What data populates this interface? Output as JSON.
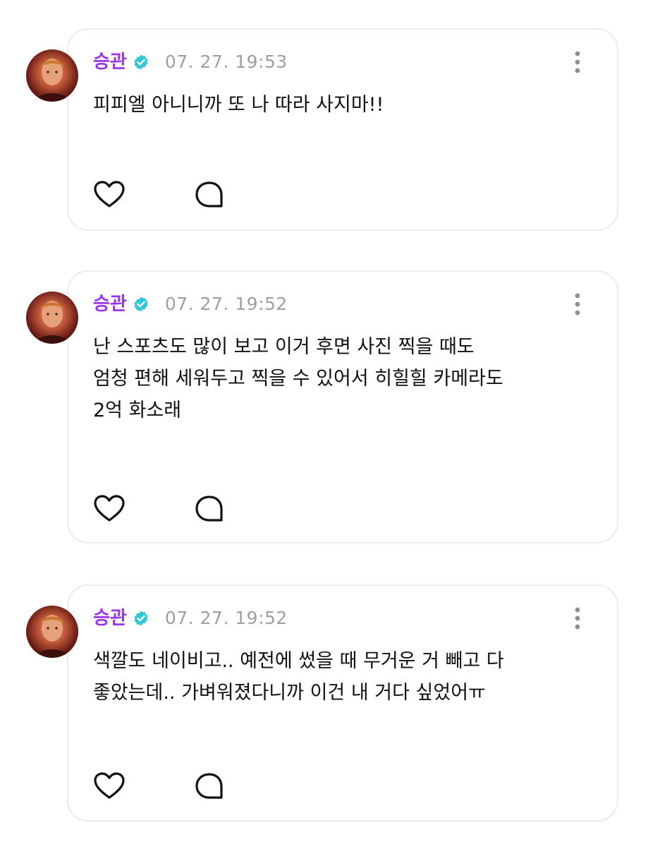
{
  "colors": {
    "author": "#9b35e8",
    "timestamp": "#9e9ea5",
    "verified_badge": "#2ec8d6",
    "card_border": "#ececef",
    "text": "#111111"
  },
  "posts": [
    {
      "author": "승관",
      "verified_icon": "verified-badge-icon",
      "timestamp": "07. 27. 19:53",
      "message": "피피엘 아니니까 또 나 따라 사지마!!",
      "actions": [
        "heart-icon",
        "comment-bubble-icon"
      ],
      "menu_icon": "more-vertical-icon"
    },
    {
      "author": "승관",
      "verified_icon": "verified-badge-icon",
      "timestamp": "07. 27. 19:52",
      "message": "난 스포츠도 많이 보고 이거 후면 사진 찍을 때도\n엄청 편해 세워두고 찍을 수 있어서 히힐힐 카메라도\n2억 화소래",
      "actions": [
        "heart-icon",
        "comment-bubble-icon"
      ],
      "menu_icon": "more-vertical-icon"
    },
    {
      "author": "승관",
      "verified_icon": "verified-badge-icon",
      "timestamp": "07. 27. 19:52",
      "message": "색깔도 네이비고.. 예전에 썼을 때 무거운 거 빼고 다\n좋았는데.. 가벼워졌다니까 이건 내 거다 싶었어ㅠ",
      "actions": [
        "heart-icon",
        "comment-bubble-icon"
      ],
      "menu_icon": "more-vertical-icon"
    }
  ]
}
